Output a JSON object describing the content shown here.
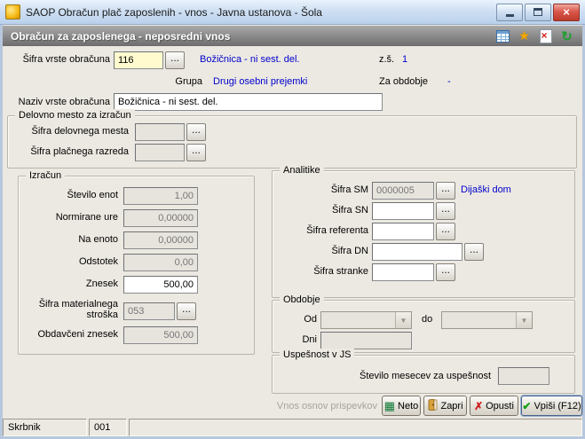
{
  "window": {
    "title": "SAOP Obračun plač zaposlenih - vnos - Javna ustanova - Šola"
  },
  "subheader": {
    "title": "Obračun za zaposlenega - neposredni vnos"
  },
  "icons": {
    "close": "×",
    "star": "★",
    "refresh": "↻",
    "delete_mark": "×",
    "dropdown": "▼",
    "check": "✔",
    "cancel": "✗",
    "grid": "▦"
  },
  "ui": {
    "ellipsis": "..."
  },
  "top": {
    "sifra_vrste": {
      "label": "Šifra vrste obračuna",
      "value": "116",
      "desc": "Božičnica - ni sest. del."
    },
    "zs": {
      "label": "z.š.",
      "value": "1"
    },
    "grupa": {
      "label": "Grupa",
      "value": "Drugi osebni prejemki"
    },
    "za_obdobje": {
      "label": "Za obdobje",
      "value": "-"
    },
    "naziv": {
      "label": "Naziv vrste obračuna",
      "value": "Božičnica - ni sest. del."
    }
  },
  "delovno_mesto": {
    "title": "Delovno mesto za izračun",
    "sifra_dm": {
      "label": "Šifra delovnega mesta",
      "value": ""
    },
    "sifra_pr": {
      "label": "Šifra plačnega razreda",
      "value": ""
    }
  },
  "izracun": {
    "title": "Izračun",
    "stevilo_enot": {
      "label": "Število enot",
      "value": "1,00"
    },
    "normirane_ure": {
      "label": "Normirane ure",
      "value": "0,00000"
    },
    "na_enoto": {
      "label": "Na enoto",
      "value": "0,00000"
    },
    "odstotek": {
      "label": "Odstotek",
      "value": "0,00"
    },
    "znesek": {
      "label": "Znesek",
      "value": "500,00"
    },
    "sifra_ms": {
      "label": "Šifra materialnega stroška",
      "value": "053"
    },
    "obdavceni_znesek": {
      "label": "Obdavčeni znesek",
      "value": "500,00"
    }
  },
  "analitike": {
    "title": "Analitike",
    "sm": {
      "label": "Šifra SM",
      "value": "0000005",
      "desc": "Dijaški dom"
    },
    "sn": {
      "label": "Šifra SN",
      "value": ""
    },
    "referent": {
      "label": "Šifra referenta",
      "value": ""
    },
    "dn": {
      "label": "Šifra DN",
      "value": ""
    },
    "stranka": {
      "label": "Šifra stranke",
      "value": ""
    }
  },
  "obdobje": {
    "title": "Obdobje",
    "od_label": "Od",
    "do_label": "do",
    "dni_label": "Dni",
    "od_value": "",
    "do_value": "",
    "dni_value": ""
  },
  "uspesnost": {
    "title": "Uspešnost v JS",
    "label": "Število mesecev za uspešnost",
    "value": ""
  },
  "footer": {
    "disabled_link": "Vnos osnov prispevkov",
    "neto": "Neto",
    "zapri": "Zapri",
    "opusti": "Opusti",
    "vpisi": "Vpiši (F12)"
  },
  "statusbar": {
    "user": "Skrbnik",
    "code": "001"
  }
}
